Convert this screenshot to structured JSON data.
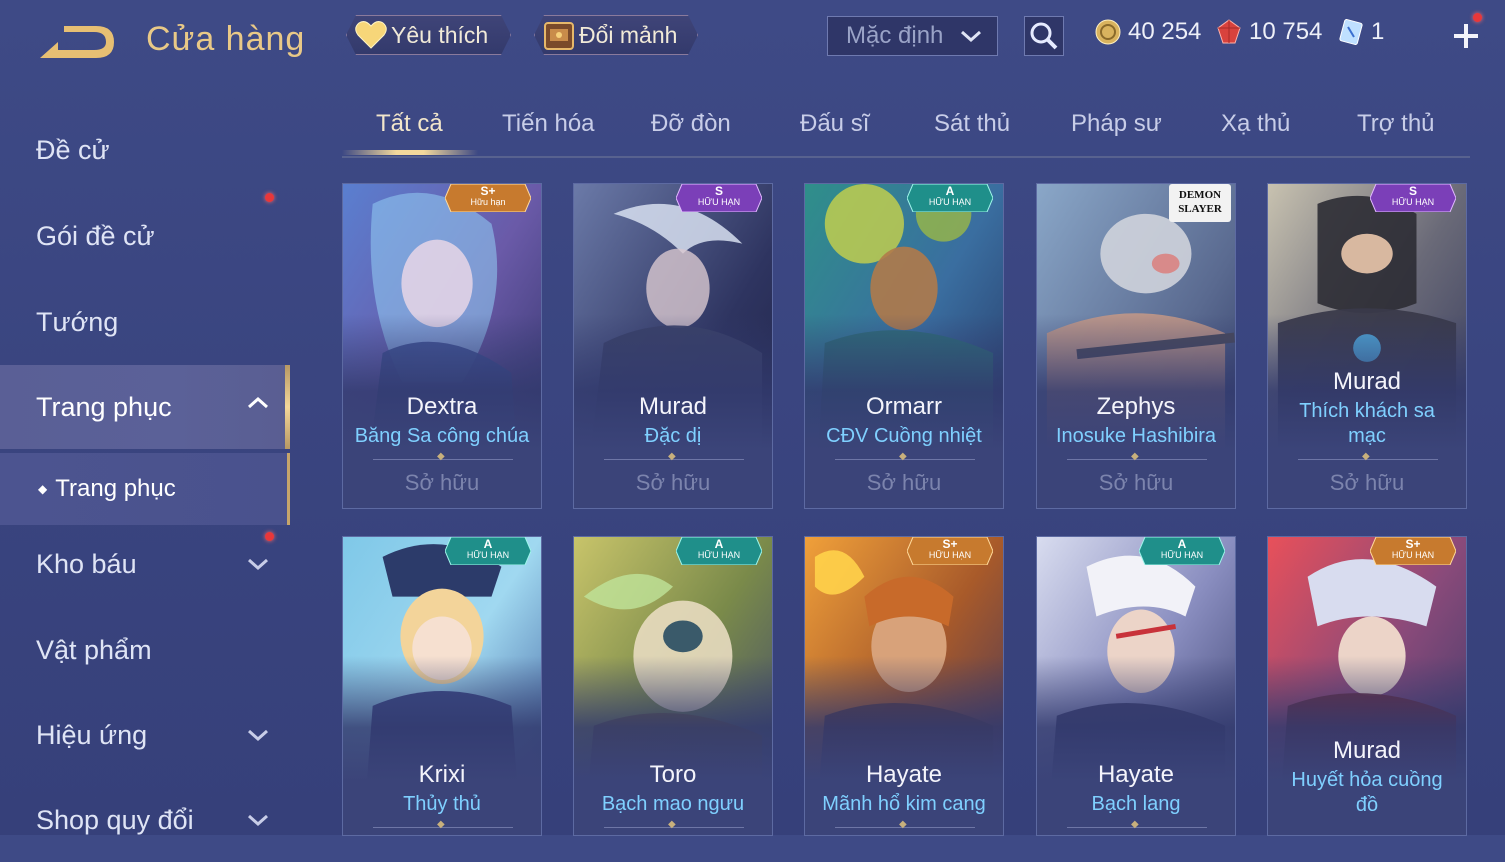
{
  "header": {
    "title": "Cửa hàng",
    "favorites_label": "Yêu thích",
    "exchange_label": "Đổi mảnh",
    "sort_value": "Mặc định",
    "currencies": [
      {
        "name": "gold",
        "icon": "gold-coin-icon",
        "value": "40 254"
      },
      {
        "name": "vouchers",
        "icon": "red-gem-icon",
        "value": "10 754"
      },
      {
        "name": "tickets",
        "icon": "blue-ticket-icon",
        "value": "1"
      }
    ]
  },
  "sidebar": {
    "items": [
      {
        "label": "Đề cử"
      },
      {
        "label": "Gói đề cử"
      },
      {
        "label": "Tướng"
      },
      {
        "label": "Trang phục"
      },
      {
        "label": "Kho báu"
      },
      {
        "label": "Vật phẩm"
      },
      {
        "label": "Hiệu ứng"
      },
      {
        "label": "Shop quy đổi"
      }
    ],
    "sub_item": "Trang phục"
  },
  "tabs": [
    "Tất cả",
    "Tiến hóa",
    "Đỡ đòn",
    "Đấu sĩ",
    "Sát thủ",
    "Pháp sư",
    "Xạ thủ",
    "Trợ thủ"
  ],
  "cards": [
    {
      "hero": "Dextra",
      "skin": "Băng Sa công chúa",
      "status": "Sở hữu",
      "tier": "S+",
      "limited": "Hữu hạn"
    },
    {
      "hero": "Murad",
      "skin": "Đặc dị",
      "status": "Sở hữu",
      "tier": "S",
      "limited": "HỮU HẠN"
    },
    {
      "hero": "Ormarr",
      "skin": "CĐV Cuồng nhiệt",
      "status": "Sở hữu",
      "tier": "A",
      "limited": "HỮU HẠN"
    },
    {
      "hero": "Zephys",
      "skin": "Inosuke Hashibira",
      "status": "Sở hữu",
      "tier": "",
      "limited": "",
      "logo": "DEMON SLAYER"
    },
    {
      "hero": "Murad",
      "skin": "Thích khách sa mạc",
      "status": "Sở hữu",
      "tier": "S",
      "limited": "HỮU HẠN"
    },
    {
      "hero": "Krixi",
      "skin": "Thủy thủ",
      "status": "",
      "tier": "A",
      "limited": "HỮU HẠN"
    },
    {
      "hero": "Toro",
      "skin": "Bạch mao ngưu",
      "status": "",
      "tier": "A",
      "limited": "HỮU HẠN"
    },
    {
      "hero": "Hayate",
      "skin": "Mãnh hổ kim cang",
      "status": "",
      "tier": "S+",
      "limited": "HỮU HẠN"
    },
    {
      "hero": "Hayate",
      "skin": "Bạch lang",
      "status": "",
      "tier": "A",
      "limited": "HỮU HẠN"
    },
    {
      "hero": "Murad",
      "skin": "Huyết hỏa cuồng đồ",
      "status": "",
      "tier": "S+",
      "limited": "HỮU HẠN"
    }
  ],
  "colors": {
    "accent_gold": "#e9c987",
    "skin_name_blue": "#7fd0ff",
    "badge_gold": "#c77a2e",
    "badge_purple": "#7b3fb8",
    "badge_teal": "#1f8f8a",
    "notification_red": "#e8373a"
  }
}
